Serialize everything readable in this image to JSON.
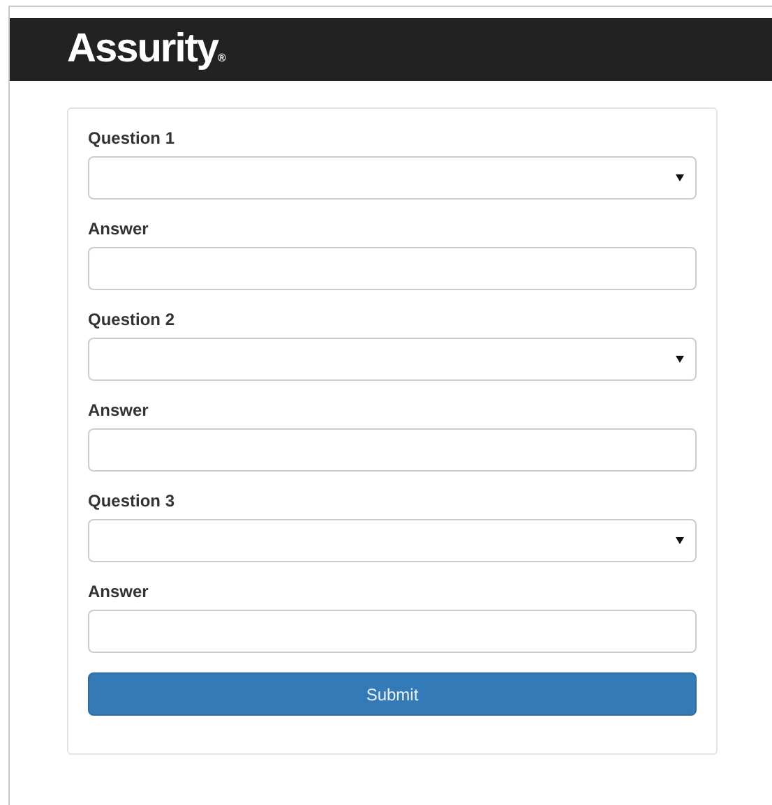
{
  "header": {
    "logo": "Assurity$_{®}$"
  },
  "form": {
    "fields": [
      {
        "kind": "select",
        "label": "Question 1"
      },
      {
        "kind": "text",
        "label": "Answer"
      },
      {
        "kind": "select",
        "label": "Question 2"
      },
      {
        "kind": "text",
        "label": "Answer"
      },
      {
        "kind": "select",
        "label": "Question 3"
      },
      {
        "kind": "text",
        "label": "Answer"
      }
    ],
    "submit": "Submit"
  }
}
